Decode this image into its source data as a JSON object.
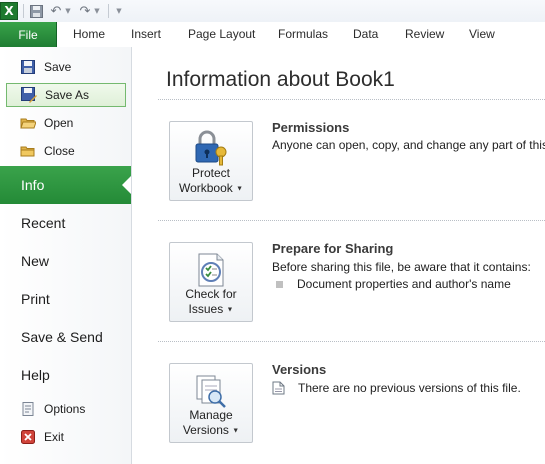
{
  "qat": {
    "app_icon": "excel-logo",
    "app_letter": "X",
    "save_icon": "save-icon",
    "undo_icon": "undo-icon",
    "redo_icon": "redo-icon",
    "customize_icon": "customize-qat-icon"
  },
  "ribbon": {
    "file_tab": "File",
    "tabs": [
      "Home",
      "Insert",
      "Page Layout",
      "Formulas",
      "Data",
      "Review",
      "View"
    ]
  },
  "backstage_nav": {
    "commands": [
      {
        "label": "Save",
        "icon": "save-icon"
      },
      {
        "label": "Save As",
        "icon": "save-as-icon",
        "highlighted": true
      },
      {
        "label": "Open",
        "icon": "open-folder-icon"
      },
      {
        "label": "Close",
        "icon": "close-folder-icon"
      }
    ],
    "sections": [
      {
        "label": "Info",
        "active": true
      },
      {
        "label": "Recent"
      },
      {
        "label": "New"
      },
      {
        "label": "Print"
      },
      {
        "label": "Save & Send"
      },
      {
        "label": "Help"
      }
    ],
    "bottom": [
      {
        "label": "Options",
        "icon": "options-icon"
      },
      {
        "label": "Exit",
        "icon": "exit-icon"
      }
    ]
  },
  "info": {
    "title": "Information about Book1",
    "permissions": {
      "button_line1": "Protect",
      "button_line2": "Workbook",
      "button_icon": "lock-keys-icon",
      "heading": "Permissions",
      "description": "Anyone can open, copy, and change any part of this"
    },
    "sharing": {
      "button_line1": "Check for",
      "button_line2": "Issues",
      "button_icon": "checklist-icon",
      "heading": "Prepare for Sharing",
      "description": "Before sharing this file, be aware that it contains:",
      "items": [
        "Document properties and author's name"
      ]
    },
    "versions": {
      "button_line1": "Manage",
      "button_line2": "Versions",
      "button_icon": "manage-versions-icon",
      "heading": "Versions",
      "description": "There are no previous versions of this file.",
      "description_icon": "document-icon"
    }
  },
  "colors": {
    "accent_green": "#2a8f3b",
    "nav_highlight_border": "#74b96f"
  }
}
